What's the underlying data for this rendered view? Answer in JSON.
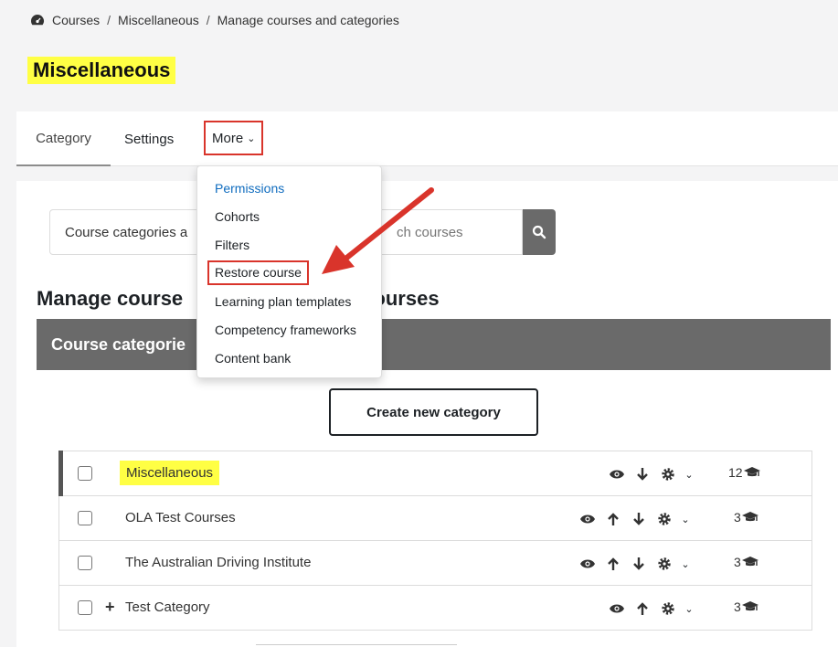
{
  "breadcrumb": {
    "items": [
      "Courses",
      "Miscellaneous",
      "Manage courses and categories"
    ],
    "separator": "/"
  },
  "page_title": "Miscellaneous",
  "tabs": {
    "category": "Category",
    "settings": "Settings",
    "more": "More"
  },
  "more_menu": {
    "items": [
      "Permissions",
      "Cohorts",
      "Filters",
      "Restore course",
      "Learning plan templates",
      "Competency frameworks",
      "Content bank"
    ]
  },
  "search": {
    "select_value": "Course categories a",
    "placeholder": "ch courses"
  },
  "heading": {
    "left": "Manage course",
    "right": "courses"
  },
  "panel_header": "Course categorie",
  "create_button": "Create new category",
  "categories": [
    {
      "name": "Miscellaneous",
      "count": "12"
    },
    {
      "name": "OLA Test Courses",
      "count": "3"
    },
    {
      "name": "The Australian Driving Institute",
      "count": "3"
    },
    {
      "name": "Test Category",
      "count": "3"
    }
  ],
  "colors": {
    "highlight": "#ffff44",
    "annotation_red": "#d9342b",
    "link_blue": "#0f6cbf",
    "panel_gray": "#6a6a6a"
  }
}
